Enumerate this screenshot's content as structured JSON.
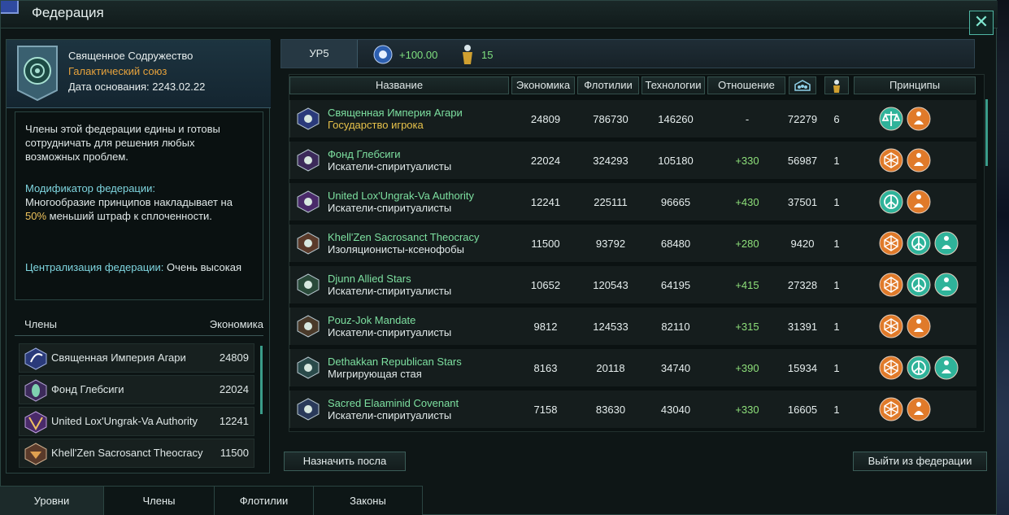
{
  "window": {
    "title": "Федерация",
    "close_label": "✕"
  },
  "federation": {
    "name": "Священное Содружество",
    "type": "Галактический союз",
    "founded": "Дата основания: 2243.02.22",
    "description": "Члены этой федерации едины и готовы\nсотрудничать для решения любых\nвозможных проблем.",
    "modifier_title": "Модификатор федерации:",
    "modifier_text_1": "Многообразие принципов накладывает на",
    "modifier_highlight": "50%",
    "modifier_text_2": " меньший штраф к сплоченности.",
    "centralization_key": "Централизация федерации:",
    "centralization_value": " Очень высокая"
  },
  "members_panel": {
    "col_members": "Члены",
    "col_economy": "Экономика",
    "items": [
      {
        "name": "Священная Империя Агари",
        "value": "24809"
      },
      {
        "name": "Фонд Глебсиги",
        "value": "22024"
      },
      {
        "name": "United Lox'Ungrak-Va Authority",
        "value": "12241"
      },
      {
        "name": "Khell'Zen Sacrosanct Theocracy",
        "value": "11500"
      }
    ]
  },
  "level_bar": {
    "level": "УР5",
    "stat1": "+100.00",
    "stat2": "15"
  },
  "table": {
    "headers": {
      "name": "Название",
      "economy": "Экономика",
      "fleets": "Флотилии",
      "tech": "Технологии",
      "relation": "Отношение",
      "principles": "Принципы"
    },
    "rows": [
      {
        "name": "Священная Империя Агари",
        "ethic": "Государство игрока",
        "economy": "24809",
        "fleets": "786730",
        "tech": "146260",
        "relation": "-",
        "pops": "72279",
        "envoys": "6",
        "principles": [
          "scales-icon",
          "meditation-icon"
        ]
      },
      {
        "name": "Фонд Глебсиги",
        "ethic": "Искатели-спиритуалисты",
        "economy": "22024",
        "fleets": "324293",
        "tech": "105180",
        "relation": "+330",
        "pops": "56987",
        "envoys": "1",
        "principles": [
          "polyhedron-icon",
          "meditation-icon"
        ]
      },
      {
        "name": "United Lox'Ungrak-Va Authority",
        "ethic": "Искатели-спиритуалисты",
        "economy": "12241",
        "fleets": "225111",
        "tech": "96665",
        "relation": "+430",
        "pops": "37501",
        "envoys": "1",
        "principles": [
          "peace-icon",
          "meditation-icon"
        ]
      },
      {
        "name": "Khell'Zen Sacrosanct Theocracy",
        "ethic": "Изоляционисты-ксенофобы",
        "economy": "11500",
        "fleets": "93792",
        "tech": "68480",
        "relation": "+280",
        "pops": "9420",
        "envoys": "1",
        "principles": [
          "polyhedron-icon",
          "peace-icon",
          "meditation-icon"
        ]
      },
      {
        "name": "Djunn Allied Stars",
        "ethic": "Искатели-спиритуалисты",
        "economy": "10652",
        "fleets": "120543",
        "tech": "64195",
        "relation": "+415",
        "pops": "27328",
        "envoys": "1",
        "principles": [
          "polyhedron-icon",
          "peace-icon",
          "meditation-icon"
        ]
      },
      {
        "name": "Pouz-Jok Mandate",
        "ethic": "Искатели-спиритуалисты",
        "economy": "9812",
        "fleets": "124533",
        "tech": "82110",
        "relation": "+315",
        "pops": "31391",
        "envoys": "1",
        "principles": [
          "polyhedron-icon",
          "meditation-icon"
        ]
      },
      {
        "name": "Dethakkan Republican Stars",
        "ethic": "Мигрирующая стая",
        "economy": "8163",
        "fleets": "20118",
        "tech": "34740",
        "relation": "+390",
        "pops": "15934",
        "envoys": "1",
        "principles": [
          "polyhedron-icon",
          "peace-icon",
          "meditation-icon"
        ]
      },
      {
        "name": "Sacred Elaaminid Covenant",
        "ethic": "Искатели-спиритуалисты",
        "economy": "7158",
        "fleets": "83630",
        "tech": "43040",
        "relation": "+330",
        "pops": "16605",
        "envoys": "1",
        "principles": [
          "polyhedron-icon",
          "meditation-icon"
        ]
      }
    ]
  },
  "buttons": {
    "assign_envoy": "Назначить посла",
    "leave_federation": "Выйти из федерации"
  },
  "tabs": {
    "levels": "Уровни",
    "members": "Члены",
    "fleets": "Флотилии",
    "laws": "Законы"
  },
  "colors": {
    "accent": "#3a9c8a",
    "relation_positive": "#8ee07a",
    "player_state": "#e6c14a",
    "principle_teal": "#2fb39a",
    "principle_orange": "#e07a2a"
  }
}
